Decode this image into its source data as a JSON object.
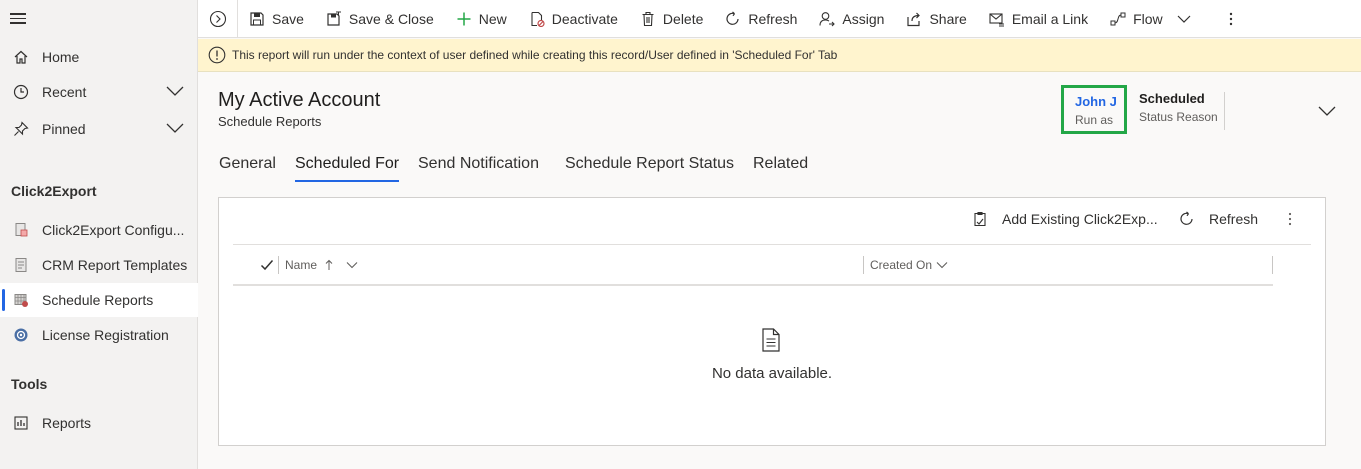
{
  "sidebar": {
    "items": [
      {
        "label": "Home"
      },
      {
        "label": "Recent"
      },
      {
        "label": "Pinned"
      }
    ],
    "sections": [
      {
        "title": "Click2Export",
        "items": [
          {
            "label": "Click2Export Configu..."
          },
          {
            "label": "CRM Report Templates"
          },
          {
            "label": "Schedule Reports"
          },
          {
            "label": "License Registration"
          }
        ]
      },
      {
        "title": "Tools",
        "items": [
          {
            "label": "Reports"
          }
        ]
      }
    ]
  },
  "toolbar": {
    "save": "Save",
    "save_close": "Save & Close",
    "new": "New",
    "deactivate": "Deactivate",
    "delete": "Delete",
    "refresh": "Refresh",
    "assign": "Assign",
    "share": "Share",
    "email_link": "Email a Link",
    "flow": "Flow"
  },
  "notice": {
    "text": "This report will run under the context of user defined while creating this record/User defined in 'Scheduled For' Tab"
  },
  "header": {
    "title": "My Active Account",
    "entity": "Schedule Reports",
    "run_as_value": "John J",
    "run_as_label": "Run as",
    "status_value": "Scheduled",
    "status_label": "Status Reason"
  },
  "tabs": [
    {
      "label": "General"
    },
    {
      "label": "Scheduled For"
    },
    {
      "label": "Send Notification"
    },
    {
      "label": "Schedule Report Status"
    },
    {
      "label": "Related"
    }
  ],
  "grid": {
    "add_existing": "Add Existing Click2Exp...",
    "refresh": "Refresh",
    "columns": [
      {
        "label": "Name"
      },
      {
        "label": "Created On"
      }
    ],
    "empty_text": "No data available."
  },
  "colors": {
    "accent": "#2266e3",
    "highlight_border": "#23a747",
    "notice_bg": "#fff4ce"
  }
}
